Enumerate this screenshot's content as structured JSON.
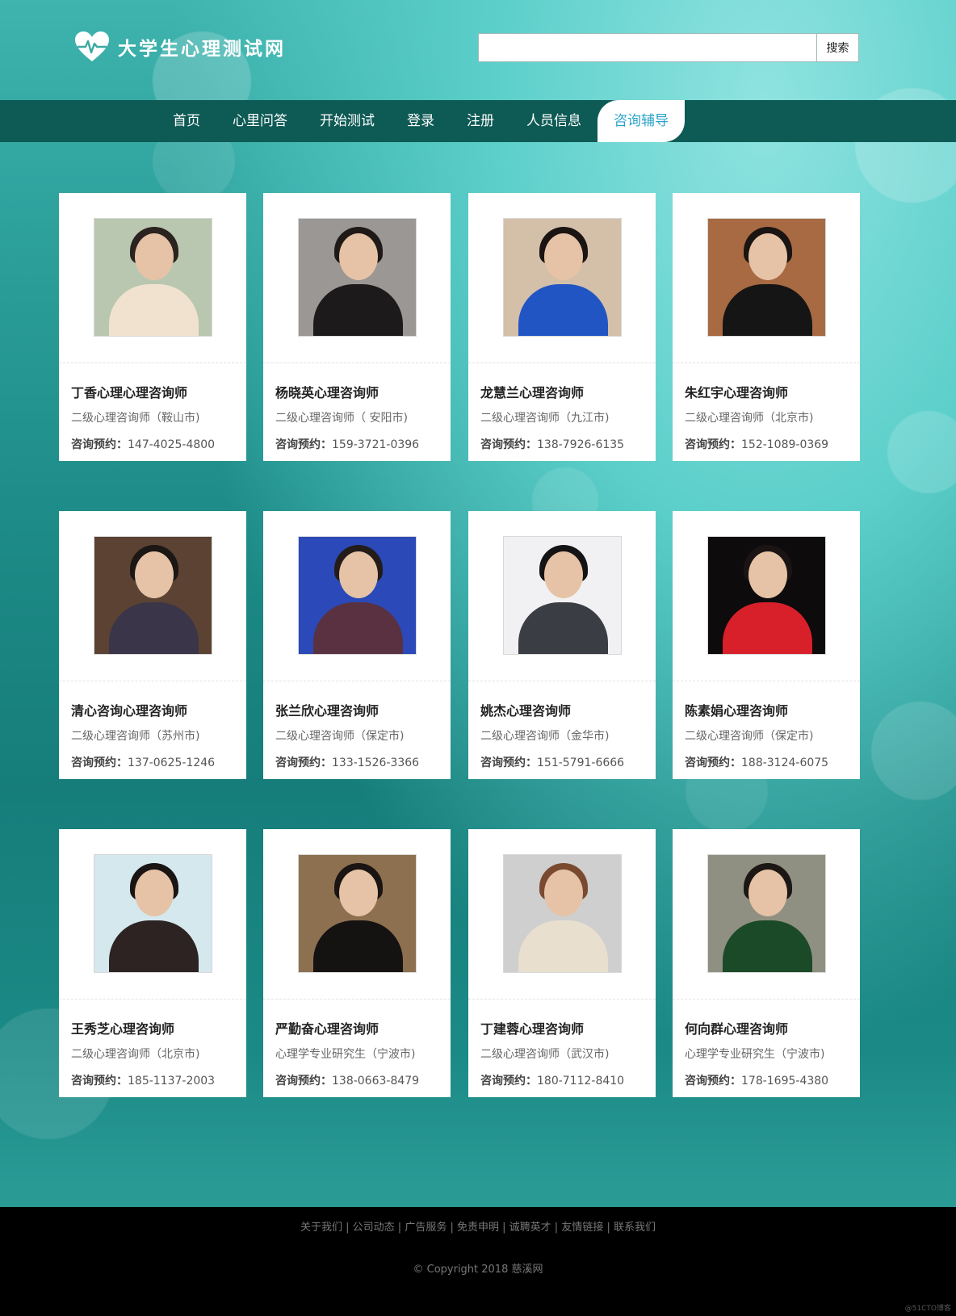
{
  "site": {
    "title": "大学生心理测试网"
  },
  "search": {
    "value": "",
    "placeholder": "",
    "button_label": "搜索"
  },
  "nav": {
    "items": [
      {
        "label": "首页"
      },
      {
        "label": "心里问答"
      },
      {
        "label": "开始测试"
      },
      {
        "label": "登录"
      },
      {
        "label": "注册"
      },
      {
        "label": "人员信息"
      },
      {
        "label": "咨询辅导",
        "active": true
      }
    ]
  },
  "counselors": [
    {
      "name": "丁香心理心理咨询师",
      "title": "二级心理咨询师（鞍山市)",
      "phone_label": "咨询预约：",
      "phone": "147-4025-4800",
      "bg": "#b9c7b0",
      "clothes": "#f1e2cf",
      "hair": "#2b2320"
    },
    {
      "name": "杨晓英心理咨询师",
      "title": "二级心理咨询师（ 安阳市)",
      "phone_label": "咨询预约：",
      "phone": "159-3721-0396",
      "bg": "#9a9794",
      "clothes": "#1c1a1a",
      "hair": "#1f1a18"
    },
    {
      "name": "龙慧兰心理咨询师",
      "title": "二级心理咨询师（九江市)",
      "phone_label": "咨询预约：",
      "phone": "138-7926-6135",
      "bg": "#d4bfa9",
      "clothes": "#2255c4",
      "hair": "#1a1513"
    },
    {
      "name": "朱红宇心理咨询师",
      "title": "二级心理咨询师（北京市)",
      "phone_label": "咨询预约：",
      "phone": "152-1089-0369",
      "bg": "#a86a42",
      "clothes": "#151515",
      "hair": "#1a1412"
    },
    {
      "name": "清心咨询心理咨询师",
      "title": "二级心理咨询师（苏州市)",
      "phone_label": "咨询预约：",
      "phone": "137-0625-1246",
      "bg": "#5b4232",
      "clothes": "#3a3548",
      "hair": "#1b1715"
    },
    {
      "name": "张兰欣心理咨询师",
      "title": "二级心理咨询师（保定市)",
      "phone_label": "咨询预约：",
      "phone": "133-1526-3366",
      "bg": "#2b49b8",
      "clothes": "#5a3141",
      "hair": "#241c19"
    },
    {
      "name": "姚杰心理咨询师",
      "title": "二级心理咨询师（金华市)",
      "phone_label": "咨询预约：",
      "phone": "151-5791-6666",
      "bg": "#f1f1f3",
      "clothes": "#3a3d44",
      "hair": "#151414"
    },
    {
      "name": "陈素娟心理咨询师",
      "title": "二级心理咨询师（保定市)",
      "phone_label": "咨询预约：",
      "phone": "188-3124-6075",
      "bg": "#0d0b0b",
      "clothes": "#d8202a",
      "hair": "#1a1414"
    },
    {
      "name": "王秀芝心理咨询师",
      "title": "二级心理咨询师（北京市)",
      "phone_label": "咨询预约：",
      "phone": "185-1137-2003",
      "bg": "#d4e8ee",
      "clothes": "#2c2322",
      "hair": "#1a1413"
    },
    {
      "name": "严勤奋心理咨询师",
      "title": "心理学专业研究生（宁波市)",
      "phone_label": "咨询预约：",
      "phone": "138-0663-8479",
      "bg": "#8d7050",
      "clothes": "#151212",
      "hair": "#1a1412"
    },
    {
      "name": "丁建蓉心理咨询师",
      "title": "二级心理咨询师（武汉市)",
      "phone_label": "咨询预约：",
      "phone": "180-7112-8410",
      "bg": "#cfcfcf",
      "clothes": "#e8dfcf",
      "hair": "#7a4a30"
    },
    {
      "name": "何向群心理咨询师",
      "title": "心理学专业研究生（宁波市)",
      "phone_label": "咨询预约：",
      "phone": "178-1695-4380",
      "bg": "#8f9081",
      "clothes": "#1b4a28",
      "hair": "#1c1614"
    }
  ],
  "footer": {
    "links": [
      "关于我们",
      "公司动态",
      "广告服务",
      "免责申明",
      "诚聘英才",
      "友情链接",
      "联系我们"
    ],
    "separator": " | ",
    "copyright": "© Copyright 2018 慈溪网",
    "watermark": "@51CTO博客"
  }
}
